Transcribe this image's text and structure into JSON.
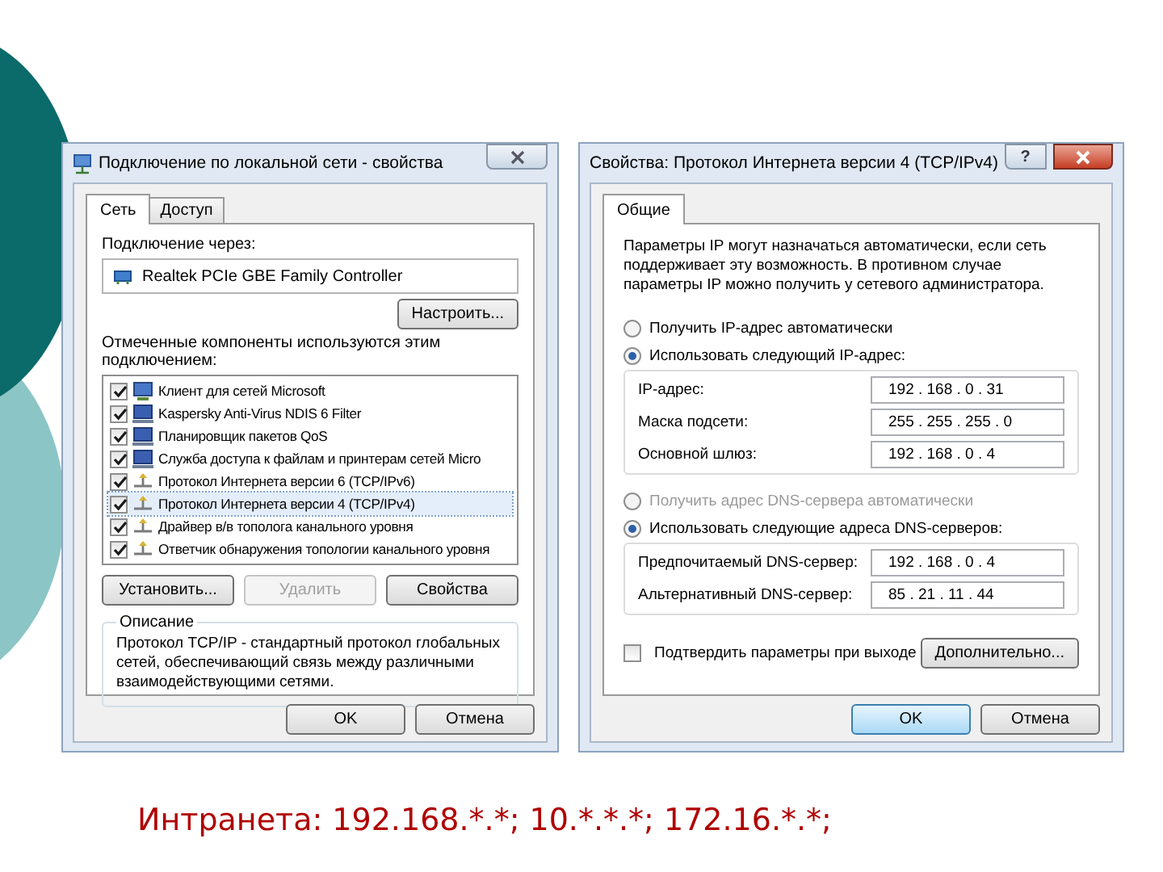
{
  "connection_dialog": {
    "title": "Подключение по локальной сети - свойства",
    "tabs": [
      {
        "label": "Сеть",
        "selected": true
      },
      {
        "label": "Доступ",
        "selected": false
      }
    ],
    "connect_using_label": "Подключение через:",
    "adapter": "Realtek PCIe GBE Family Controller",
    "configure_button": "Настроить...",
    "components_label": "Отмеченные компоненты используются этим подключением:",
    "components": [
      {
        "kind": "client",
        "label": "Клиент для сетей Microsoft",
        "checked": true,
        "selected": false
      },
      {
        "kind": "service",
        "label": "Kaspersky Anti-Virus NDIS 6 Filter",
        "checked": true,
        "selected": false
      },
      {
        "kind": "service",
        "label": "Планировщик пакетов QoS",
        "checked": true,
        "selected": false
      },
      {
        "kind": "service",
        "label": "Служба доступа к файлам и принтерам сетей Micro",
        "checked": true,
        "selected": false
      },
      {
        "kind": "protocol",
        "label": "Протокол Интернета версии 6 (TCP/IPv6)",
        "checked": true,
        "selected": false
      },
      {
        "kind": "protocol",
        "label": "Протокол Интернета версии 4 (TCP/IPv4)",
        "checked": true,
        "selected": true
      },
      {
        "kind": "protocol",
        "label": "Драйвер в/в тополога канального уровня",
        "checked": true,
        "selected": false
      },
      {
        "kind": "protocol",
        "label": "Ответчик обнаружения топологии канального уровня",
        "checked": true,
        "selected": false
      }
    ],
    "buttons": [
      {
        "label": "Установить...",
        "disabled": false
      },
      {
        "label": "Удалить",
        "disabled": true
      },
      {
        "label": "Свойства",
        "disabled": false
      }
    ],
    "description_label": "Описание",
    "description": "Протокол TCP/IP - стандартный протокол глобальных сетей, обеспечивающий связь между различными взаимодействующими сетями.",
    "footer_buttons": [
      {
        "label": "OK",
        "default": false
      },
      {
        "label": "Отмена",
        "default": false
      }
    ]
  },
  "ipv4_dialog": {
    "title": "Свойства: Протокол Интернета версии 4 (TCP/IPv4)",
    "help_button": "?",
    "tabs": [
      {
        "label": "Общие",
        "selected": true
      }
    ],
    "intro": "Параметры IP могут назначаться автоматически, если сеть поддерживает эту возможность. В противном случае параметры IP можно получить у сетевого администратора.",
    "ip_options": [
      {
        "label": "Получить IP-адрес автоматически",
        "selected": false
      },
      {
        "label": "Использовать следующий IP-адрес:",
        "selected": true
      }
    ],
    "ip_fields": [
      {
        "label": "IP-адрес:",
        "value": "192 . 168 . 0 . 31"
      },
      {
        "label": "Маска подсети:",
        "value": "255 . 255 . 255 . 0"
      },
      {
        "label": "Основной шлюз:",
        "value": "192 . 168 . 0 . 4"
      }
    ],
    "dns_options": [
      {
        "label": "Получить адрес DNS-сервера автоматически",
        "selected": false,
        "disabled": true
      },
      {
        "label": "Использовать следующие адреса DNS-серверов:",
        "selected": true,
        "disabled": false
      }
    ],
    "dns_fields": [
      {
        "label": "Предпочитаемый DNS-сервер:",
        "value": "192 . 168 . 0 . 4"
      },
      {
        "label": "Альтернативный DNS-сервер:",
        "value": "85 . 21 . 11 . 44"
      }
    ],
    "validate_checkbox": {
      "label": "Подтвердить параметры при выходе",
      "checked": false
    },
    "advanced_button": "Дополнительно...",
    "footer_buttons": [
      {
        "label": "OK",
        "default": true
      },
      {
        "label": "Отмена",
        "default": false
      }
    ]
  },
  "slide_caption": "Интранета: 192.168.*.*; 10.*.*.*; 172.16.*.*;"
}
